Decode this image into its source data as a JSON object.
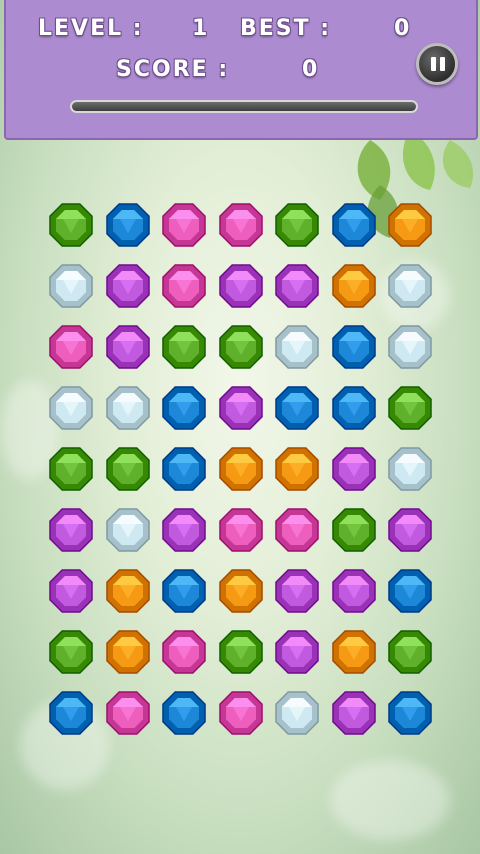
{
  "hud": {
    "level_label": "LEVEL :",
    "level_value": "1",
    "best_label": "BEST :",
    "best_value": "0",
    "score_label": "SCORE :",
    "score_value": "0",
    "progress_fraction": 0
  },
  "gem_colors": {
    "green": "#5fb02a",
    "blue": "#1e88d8",
    "pink": "#ee5fbd",
    "purple": "#c25ae0",
    "orange": "#f79a13",
    "white": "#cfe9f3"
  },
  "board": {
    "rows": [
      [
        "green",
        "blue",
        "pink",
        "pink",
        "green",
        "blue",
        "orange"
      ],
      [
        "white",
        "purple",
        "pink",
        "purple",
        "purple",
        "orange",
        "white"
      ],
      [
        "pink",
        "purple",
        "green",
        "green",
        "white",
        "blue",
        "white"
      ],
      [
        "white",
        "white",
        "blue",
        "purple",
        "blue",
        "blue",
        "green"
      ],
      [
        "green",
        "green",
        "blue",
        "orange",
        "orange",
        "purple",
        "white"
      ],
      [
        "purple",
        "white",
        "purple",
        "pink",
        "pink",
        "green",
        "purple"
      ],
      [
        "purple",
        "orange",
        "blue",
        "orange",
        "purple",
        "purple",
        "blue"
      ],
      [
        "green",
        "orange",
        "pink",
        "green",
        "purple",
        "orange",
        "green"
      ],
      [
        "blue",
        "pink",
        "blue",
        "pink",
        "white",
        "purple",
        "blue"
      ]
    ]
  }
}
